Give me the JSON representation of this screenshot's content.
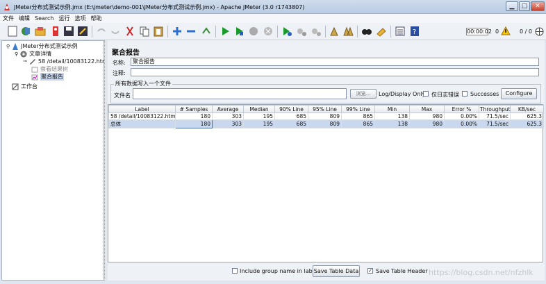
{
  "window": {
    "title": "JMeter分布式测试示例.jmx (E:\\jmeter\\demo-001\\JMeter分布式测试示例.jmx) - Apache JMeter (3.0 r1743807)",
    "minimize": "▁",
    "maximize": "□",
    "close": "✕"
  },
  "menu": [
    "文件",
    "编辑",
    "Search",
    "运行",
    "选项",
    "帮助"
  ],
  "toolbar": {
    "timer": "00:00:02",
    "warn_count": "0",
    "threads": "0 / 0"
  },
  "tree": {
    "test_plan": "JMeter分布式测试示例",
    "thread_group": "文章详情",
    "sampler": "58 /detail/10083122.html",
    "results_tree": "察看结果树",
    "aggregate": "聚合报告",
    "workbench": "工作台"
  },
  "panel": {
    "title": "聚合报告",
    "name_label": "名称:",
    "name_value": "聚合报告",
    "comment_label": "注释:",
    "comment_value": "",
    "group_title": "所有数据写入一个文件",
    "file_label": "文件名",
    "file_value": "",
    "browse_label": "浏览...",
    "log_label": "Log/Display Only:",
    "errors_label": "仅日志错误",
    "successes_label": "Successes",
    "configure_label": "Configure"
  },
  "table": {
    "headers": [
      "Label",
      "# Samples",
      "Average",
      "Median",
      "90% Line",
      "95% Line",
      "99% Line",
      "Min",
      "Max",
      "Error %",
      "Throughput",
      "KB/sec"
    ],
    "rows": [
      [
        "58 /detail/10083122.html",
        "180",
        "303",
        "195",
        "685",
        "809",
        "865",
        "138",
        "980",
        "0.00%",
        "71.5/sec",
        "625.3"
      ],
      [
        "总体",
        "180",
        "303",
        "195",
        "685",
        "809",
        "865",
        "138",
        "980",
        "0.00%",
        "71.5/sec",
        "625.3"
      ]
    ]
  },
  "bottom": {
    "include_group_label": "Include group name in label?",
    "include_group_checked": false,
    "save_table_data": "Save Table Data",
    "save_table_header": "Save Table Header",
    "save_header_checked": true,
    "watermark": "https://blog.csdn.net/nfzhlk"
  }
}
